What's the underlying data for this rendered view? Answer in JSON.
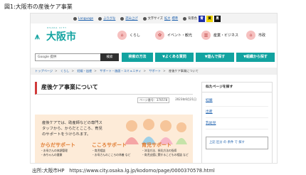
{
  "figure": {
    "caption": "図1:大阪市の産後ケア事業",
    "source": "出所:大阪市HP　https://www.city.osaka.lg.jp/kodomo/page/0000370578.html"
  },
  "utility_bar": {
    "language": "Language",
    "furigana": "ふりがな",
    "read_aloud": "読み上げ",
    "text_size_label": "文字サイズ",
    "enlarge": "拡大",
    "standard": "標準",
    "bg_color_label": "背景色",
    "bg_blue": "青",
    "bg_yellow": "黄",
    "bg_black": "黒",
    "colors": {
      "blue": "#1c2fa8",
      "yellow": "#f2d600",
      "black": "#111111"
    }
  },
  "header": {
    "logo_sub": "OSAKA CITY",
    "logo_text": "大阪市",
    "categories": [
      {
        "label": "くらし",
        "icon": "house-icon"
      },
      {
        "label": "イベント・観光",
        "icon": "event-icon"
      },
      {
        "label": "産業・ビジネス",
        "icon": "building-icon"
      },
      {
        "label": "市政",
        "icon": "city-hall-icon"
      }
    ]
  },
  "search": {
    "engine": "Google 提供",
    "button": "検索"
  },
  "nav": {
    "items": [
      "検索の方法",
      "▼よくある質問",
      "▼遊んで探す",
      "▼組織から探す"
    ]
  },
  "breadcrumb": {
    "items": [
      "トップページ",
      "くらし",
      "妊娠・出産",
      "サポート・施設・コミュニティ",
      "サポート"
    ],
    "current": "産後ケア事業について"
  },
  "page": {
    "title": "産後ケア事業について",
    "page_id": "ページ番号：370578",
    "date": "2023年6月21日"
  },
  "banner": {
    "intro": "産後ケアでは、助産師などの専門スタッフから、からだとこころ、育児のサポートをうけられます。",
    "columns": [
      {
        "heading": "からだサポート",
        "items": [
          "・お母さんの体調管理",
          "・赤ちゃんの健康"
        ]
      },
      {
        "heading": "こころサポート",
        "items": [
          "・育児相談",
          "・お母さんのこころの休養 など"
        ]
      },
      {
        "heading": "育児サポート",
        "items": [
          "・沐浴方法、授乳方法の指導",
          "・育児支援に関するこどもの相談 など"
        ]
      }
    ]
  },
  "sidebar": {
    "heading": "似たページを探す",
    "links": [
      "妊娠",
      "出産",
      "乳幼児"
    ],
    "box": "上記 区分 の 条件 で 探す"
  },
  "colors": {
    "brand": "#12a3a0",
    "accent_red": "#d03a3a",
    "banner": "#fdebd8",
    "banner_heading": "#e07a2e"
  }
}
